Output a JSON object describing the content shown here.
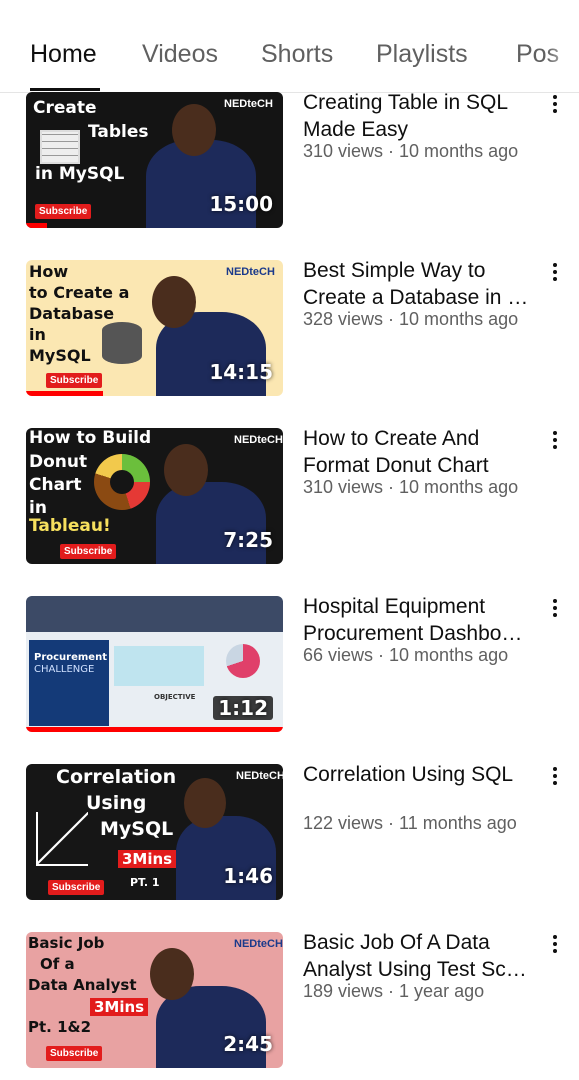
{
  "tabs": [
    {
      "label": "Home",
      "active": true
    },
    {
      "label": "Videos",
      "active": false
    },
    {
      "label": "Shorts",
      "active": false
    },
    {
      "label": "Playlists",
      "active": false
    },
    {
      "label": "Pos",
      "active": false
    }
  ],
  "videos": [
    {
      "title": "Creating Table in SQL Made Easy",
      "meta": "310 views · 10 months ago",
      "duration": "15:00",
      "progress": 0.08,
      "thumb": {
        "lines": [
          "Create",
          "Tables",
          "in MySQL"
        ],
        "badge": "Subscribe",
        "brand": "NEDteCH",
        "bg": "#141414",
        "text": "#ffffff"
      }
    },
    {
      "title": "Best Simple Way to Create a Database in …",
      "meta": "328 views · 10 months ago",
      "duration": "14:15",
      "progress": 0.3,
      "thumb": {
        "lines": [
          "How",
          "to Create a",
          "Database",
          "in",
          "MySQL"
        ],
        "badge": "Subscribe",
        "brand": "NEDteCH",
        "bg": "#fbe7b2",
        "text": "#111111"
      }
    },
    {
      "title": "How to Create And Format Donut Chart",
      "meta": "310 views · 10 months ago",
      "duration": "7:25",
      "progress": 0,
      "thumb": {
        "lines": [
          "How to Build",
          "Donut",
          "Chart",
          "in",
          "Tableau!"
        ],
        "badge": "Subscribe",
        "brand": "NEDteCH",
        "bg": "#151515",
        "text": "#ffffff"
      }
    },
    {
      "title": "Hospital Equipment Procurement Dashbo…",
      "meta": "66 views · 10 months ago",
      "duration": "1:12",
      "progress": 1,
      "thumb": {
        "lines": [
          "Procurement",
          "CHALLENGE",
          "OBJECTIVE"
        ],
        "badge": "",
        "brand": "",
        "bg": "#e9eef3",
        "text": "#1b3a6b"
      }
    },
    {
      "title": "Correlation Using SQL",
      "meta": "122 views · 11 months ago",
      "duration": "1:46",
      "progress": 0,
      "thumb": {
        "lines": [
          "Correlation",
          "Using",
          "MySQL",
          "3Mins",
          "PT. 1"
        ],
        "badge": "Subscribe",
        "brand": "NEDteCH",
        "bg": "#161616",
        "text": "#ffffff"
      }
    },
    {
      "title": "Basic Job Of A Data Analyst Using Test Sc…",
      "meta": "189 views · 1 year ago",
      "duration": "2:45",
      "progress": 0,
      "thumb": {
        "lines": [
          "Basic Job",
          "Of a",
          "Data Analyst",
          "3Mins",
          "Pt. 1&2"
        ],
        "badge": "Subscribe",
        "brand": "NEDteCH",
        "bg": "#e8a2a2",
        "text": "#111111"
      }
    }
  ],
  "colors": {
    "accent": "#ff0000",
    "text": "#0f0f0f",
    "secondary": "#606060"
  }
}
